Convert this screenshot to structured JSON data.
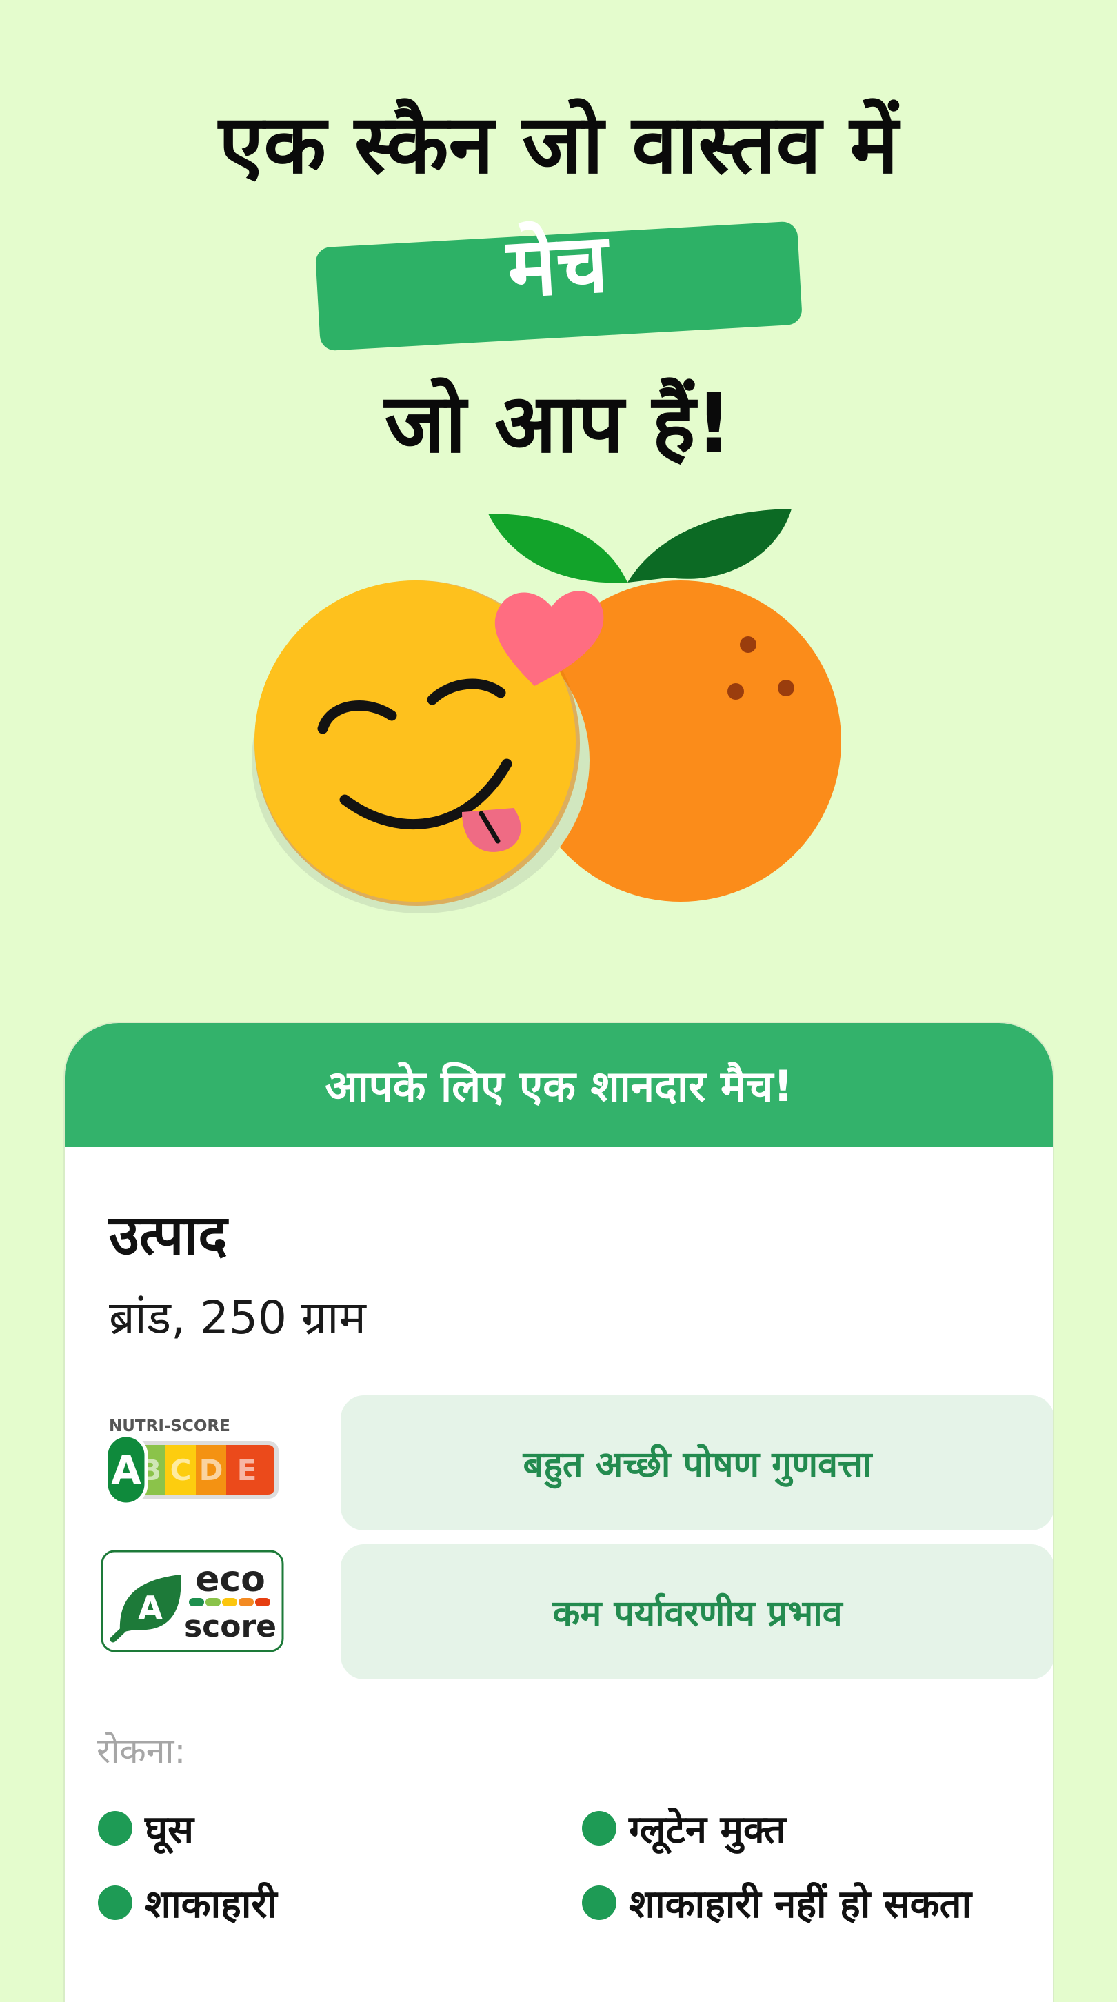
{
  "headline": {
    "line1": "एक स्कैन जो वास्तव में",
    "highlight": "मेच",
    "line3": "जो आप हैं!"
  },
  "illustration": {
    "icons": [
      "smiling-face-icon",
      "heart-icon",
      "orange-fruit-icon",
      "leaf-icon"
    ]
  },
  "card": {
    "header": "आपके लिए एक शानदार मैच!",
    "product_name": "उत्पाद",
    "product_brand": "ब्रांड, 250 ग्राम",
    "nutriscore": {
      "logo_title": "NUTRI-SCORE",
      "letters": [
        "A",
        "B",
        "C",
        "D",
        "E"
      ],
      "grade": "A",
      "description": "बहुत अच्छी पोषण गुणवत्ता"
    },
    "ecoscore": {
      "grade": "A",
      "logo_word1": "eco",
      "logo_word2": "score",
      "description": "कम पर्यावरणीय प्रभाव"
    },
    "contains_label": "रोकना:",
    "attributes": [
      "घूस",
      "ग्लूटेन मुक्त",
      "शाकाहारी",
      "शाकाहारी नहीं हो सकता"
    ]
  },
  "colors": {
    "background": "#e4fccd",
    "accent_green": "#2db166",
    "header_green": "#33b26b",
    "pill_bg": "#e5f3e8",
    "dot_green": "#1e9b55"
  }
}
